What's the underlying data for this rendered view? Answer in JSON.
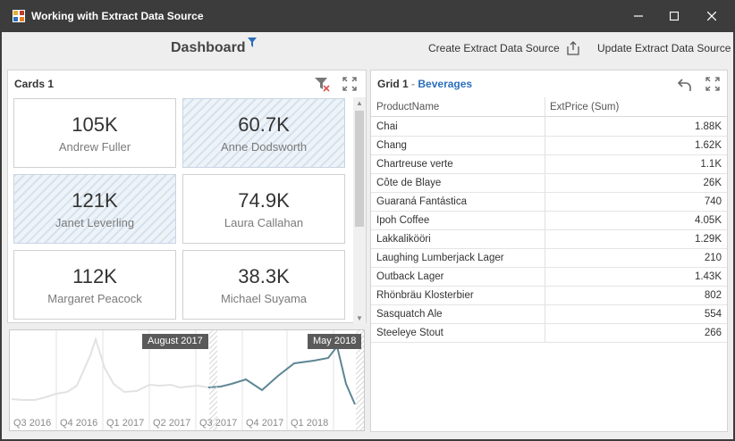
{
  "window": {
    "title": "Working with Extract Data Source",
    "minimize": "—",
    "maximize": "☐",
    "close": "✕"
  },
  "dashboard": {
    "title": "Dashboard",
    "create_label": "Create Extract Data Source",
    "update_label": "Update Extract Data Source"
  },
  "cards_panel": {
    "title": "Cards 1",
    "cards": [
      {
        "value": "105K",
        "name": "Andrew Fuller",
        "selected": false
      },
      {
        "value": "60.7K",
        "name": "Anne Dodsworth",
        "selected": true
      },
      {
        "value": "121K",
        "name": "Janet Leverling",
        "selected": true
      },
      {
        "value": "74.9K",
        "name": "Laura Callahan",
        "selected": false
      },
      {
        "value": "112K",
        "name": "Margaret Peacock",
        "selected": false
      },
      {
        "value": "38.3K",
        "name": "Michael Suyama",
        "selected": false
      }
    ]
  },
  "range": {
    "start_label": "August 2017",
    "end_label": "May 2018",
    "x_labels": [
      "Q3 2016",
      "Q4 2016",
      "Q1 2017",
      "Q2 2017",
      "Q3 2017",
      "Q4 2017",
      "Q1 2018"
    ],
    "selected_color": "#5e8694",
    "unselected_color": "#e2e2e2"
  },
  "grid_panel": {
    "title": "Grid 1",
    "title_sub": "Beverages",
    "columns": [
      "ProductName",
      "ExtPrice (Sum)"
    ],
    "rows": [
      {
        "name": "Chai",
        "value": "1.88K"
      },
      {
        "name": "Chang",
        "value": "1.62K"
      },
      {
        "name": "Chartreuse verte",
        "value": "1.1K"
      },
      {
        "name": "Côte de Blaye",
        "value": "26K"
      },
      {
        "name": "Guaraná Fantástica",
        "value": "740"
      },
      {
        "name": "Ipoh Coffee",
        "value": "4.05K"
      },
      {
        "name": "Lakkalikööri",
        "value": "1.29K"
      },
      {
        "name": "Laughing Lumberjack Lager",
        "value": "210"
      },
      {
        "name": "Outback Lager",
        "value": "1.43K"
      },
      {
        "name": "Rhönbräu Klosterbier",
        "value": "802"
      },
      {
        "name": "Sasquatch Ale",
        "value": "554"
      },
      {
        "name": "Steeleye Stout",
        "value": "266"
      }
    ]
  },
  "colors": {
    "accent": "#2a6ebb",
    "filter_icon": "#2a6ebb",
    "clear_filter_x": "#d9534f"
  }
}
